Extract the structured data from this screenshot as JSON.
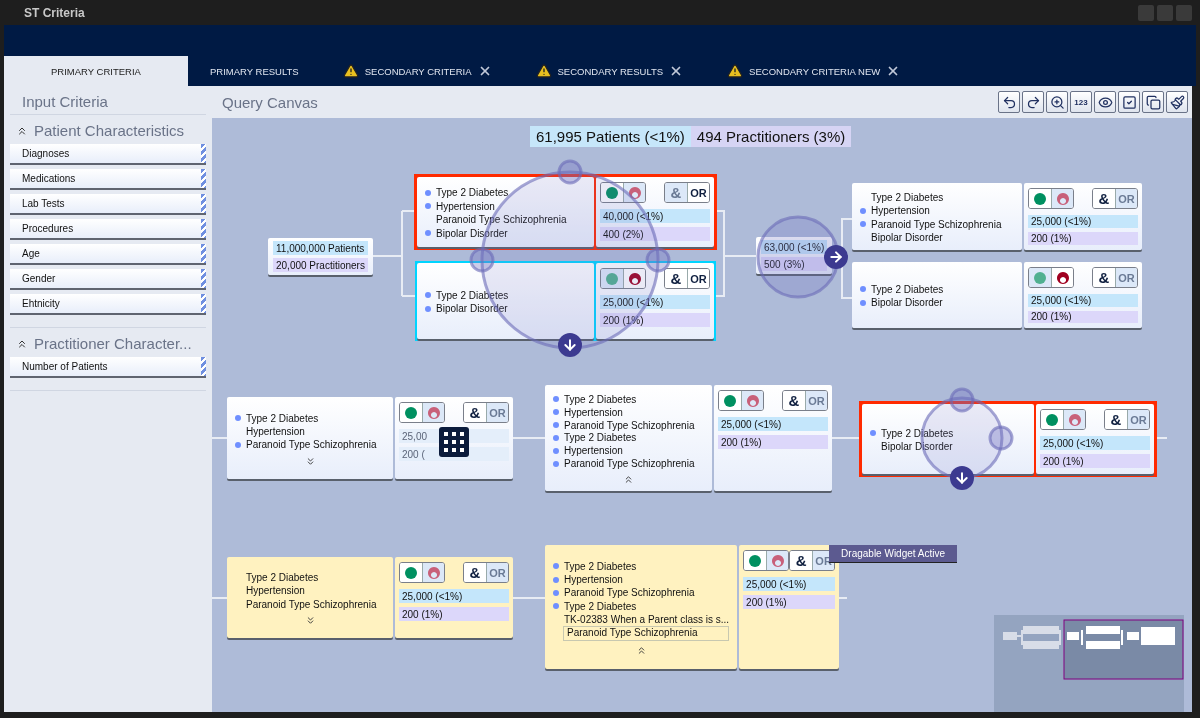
{
  "window": {
    "title": "ST Criteria"
  },
  "tabs": [
    {
      "label": "PRIMARY CRITERIA",
      "selected": true,
      "warning": false,
      "closable": false
    },
    {
      "label": "PRIMARY RESULTS",
      "selected": false,
      "warning": false,
      "closable": false
    },
    {
      "label": "SECONDARY CRITERIA",
      "selected": false,
      "warning": true,
      "closable": true
    },
    {
      "label": "SECONDARY RESULTS",
      "selected": false,
      "warning": true,
      "closable": true
    },
    {
      "label": "SECONDARY CRITERIA NEW",
      "selected": false,
      "warning": true,
      "closable": true
    }
  ],
  "sidebar": {
    "title": "Input Criteria",
    "sections": [
      {
        "title": "Patient Characteristics",
        "expanded": true,
        "items": [
          "Diagnoses",
          "Medications",
          "Lab Tests",
          "Procedures",
          "Age",
          "Gender",
          "Ehtnicity"
        ]
      },
      {
        "title": "Practitioner Character...",
        "expanded": true,
        "items": [
          "Number of Patients"
        ]
      }
    ]
  },
  "canvas": {
    "title": "Query Canvas",
    "toolbar": [
      {
        "kind": "undo"
      },
      {
        "kind": "redo"
      },
      {
        "kind": "zoom"
      },
      {
        "kind": "numbers",
        "label": "123"
      },
      {
        "kind": "eye"
      },
      {
        "kind": "check"
      },
      {
        "kind": "copy"
      },
      {
        "kind": "brush"
      }
    ],
    "summary": {
      "patients_count": "61,995",
      "patients_label": "Patients (<1%)",
      "practitioners_count": "494",
      "practitioners_label": "Practitioners (3%)"
    },
    "nodes": [
      {
        "kind": "source",
        "patients": "11,000,000 Patients",
        "practitioners": "20,000 Practitioners"
      },
      {
        "kind": "criteria",
        "selected": true,
        "drop_target": false,
        "highlighted": false,
        "filters": [
          {
            "kind": "include",
            "selected": true
          },
          {
            "kind": "exclude",
            "selected": false
          }
        ],
        "operators": [
          {
            "label": "&",
            "selected": false
          },
          {
            "label": "OR",
            "selected": true
          }
        ],
        "items": [
          {
            "text": "Type 2 Diabetes",
            "bullet": true
          },
          {
            "text": "Hypertension",
            "bullet": true
          },
          {
            "text": "Paranoid Type Schizophrenia",
            "bullet": false
          },
          {
            "text": "Bipolar Disorder",
            "bullet": true
          }
        ],
        "patients": "40,000 (<1%)",
        "practitioners": "400 (2%)"
      },
      {
        "kind": "criteria",
        "selected": false,
        "drop_target": true,
        "highlighted": false,
        "filters": [
          {
            "kind": "include",
            "selected": false
          },
          {
            "kind": "exclude",
            "selected": true
          }
        ],
        "operators": [
          {
            "label": "&",
            "selected": true
          },
          {
            "label": "OR",
            "selected": true
          }
        ],
        "items": [
          {
            "text": "Type 2 Diabetes",
            "bullet": true
          },
          {
            "text": "Bipolar Disorder",
            "bullet": true
          }
        ],
        "patients": "25,000 (<1%)",
        "practitioners": "200 (1%)"
      },
      {
        "kind": "junction",
        "patients": "63,000 (<1%)",
        "practitioners": "500 (3%)"
      },
      {
        "kind": "criteria",
        "selected": false,
        "drop_target": false,
        "highlighted": false,
        "filters": [
          {
            "kind": "include",
            "selected": true
          },
          {
            "kind": "exclude",
            "selected": false
          }
        ],
        "operators": [
          {
            "label": "&",
            "selected": true
          },
          {
            "label": "OR",
            "selected": false
          }
        ],
        "items": [
          {
            "text": "Type 2 Diabetes",
            "bullet": false
          },
          {
            "text": "Hypertension",
            "bullet": true
          },
          {
            "text": "Paranoid Type Schizophrenia",
            "bullet": true
          },
          {
            "text": "Bipolar Disorder",
            "bullet": false
          }
        ],
        "patients": "25,000 (<1%)",
        "practitioners": "200 (1%)"
      },
      {
        "kind": "criteria",
        "selected": false,
        "drop_target": false,
        "highlighted": false,
        "filters": [
          {
            "kind": "include",
            "selected": false
          },
          {
            "kind": "exclude",
            "selected": true
          }
        ],
        "operators": [
          {
            "label": "&",
            "selected": true
          },
          {
            "label": "OR",
            "selected": false
          }
        ],
        "items": [
          {
            "text": "Type 2 Diabetes",
            "bullet": true
          },
          {
            "text": "Bipolar Disorder",
            "bullet": true
          }
        ],
        "patients": "25,000 (<1%)",
        "practitioners": "200 (1%)"
      },
      {
        "kind": "criteria",
        "selected": false,
        "drop_target": false,
        "highlighted": false,
        "expanded": false,
        "dimmed": true,
        "filters": [
          {
            "kind": "include",
            "selected": true
          },
          {
            "kind": "exclude",
            "selected": false
          }
        ],
        "operators": [
          {
            "label": "&",
            "selected": true
          },
          {
            "label": "OR",
            "selected": false
          }
        ],
        "items": [
          {
            "text": "Type 2 Diabetes",
            "bullet": true
          },
          {
            "text": "Hypertension",
            "bullet": false
          },
          {
            "text": "Paranoid Type Schizophrenia",
            "bullet": true
          }
        ],
        "patients": "25,00",
        "practitioners": "200 ("
      },
      {
        "kind": "criteria",
        "selected": false,
        "drop_target": false,
        "highlighted": false,
        "expanded": true,
        "filters": [
          {
            "kind": "include",
            "selected": true
          },
          {
            "kind": "exclude",
            "selected": false
          }
        ],
        "operators": [
          {
            "label": "&",
            "selected": true
          },
          {
            "label": "OR",
            "selected": false
          }
        ],
        "items": [
          {
            "text": "Type 2 Diabetes",
            "bullet": true
          },
          {
            "text": "Hypertension",
            "bullet": true
          },
          {
            "text": "Paranoid Type Schizophrenia",
            "bullet": true
          },
          {
            "text": "Type 2 Diabetes",
            "bullet": true
          },
          {
            "text": "Hypertension",
            "bullet": true
          },
          {
            "text": "Paranoid Type Schizophrenia",
            "bullet": true
          }
        ],
        "patients": "25,000 (<1%)",
        "practitioners": "200 (1%)"
      },
      {
        "kind": "criteria",
        "selected": true,
        "drop_target": false,
        "highlighted": false,
        "filters": [
          {
            "kind": "include",
            "selected": true
          },
          {
            "kind": "exclude",
            "selected": false
          }
        ],
        "operators": [
          {
            "label": "&",
            "selected": true
          },
          {
            "label": "OR",
            "selected": false
          }
        ],
        "items": [
          {
            "text": "Type 2 Diabetes",
            "bullet": true
          },
          {
            "text": "Bipolar Disorder",
            "bullet": false
          }
        ],
        "patients": "25,000 (<1%)",
        "practitioners": "200 (1%)"
      },
      {
        "kind": "criteria",
        "selected": false,
        "drop_target": false,
        "highlighted": true,
        "expanded": false,
        "filters": [
          {
            "kind": "include",
            "selected": true
          },
          {
            "kind": "exclude",
            "selected": false
          }
        ],
        "operators": [
          {
            "label": "&",
            "selected": true
          },
          {
            "label": "OR",
            "selected": false
          }
        ],
        "items": [
          {
            "text": "Type 2 Diabetes",
            "bullet": false
          },
          {
            "text": "Hypertension",
            "bullet": false
          },
          {
            "text": "Paranoid Type Schizophrenia",
            "bullet": false
          }
        ],
        "patients": "25,000 (<1%)",
        "practitioners": "200 (1%)"
      },
      {
        "kind": "criteria",
        "selected": false,
        "drop_target": false,
        "highlighted": true,
        "expanded": true,
        "tooltip": "Dragable Widget Active",
        "filters": [
          {
            "kind": "include",
            "selected": true
          },
          {
            "kind": "exclude",
            "selected": false
          }
        ],
        "operators": [
          {
            "label": "&",
            "selected": true
          },
          {
            "label": "OR",
            "selected": false
          }
        ],
        "items": [
          {
            "text": "Type 2 Diabetes",
            "bullet": true
          },
          {
            "text": "Hypertension",
            "bullet": true
          },
          {
            "text": "Paranoid Type Schizophrenia",
            "bullet": true
          },
          {
            "text": "Type 2 Diabetes",
            "bullet": true
          },
          {
            "text": "TK-02383 When a Parent class is s...",
            "bullet": false
          },
          {
            "kind": "field",
            "text": "Paranoid Type Schizophrenia"
          }
        ],
        "patients": "25,000 (<1%)",
        "practitioners": "200 (1%)"
      }
    ]
  }
}
